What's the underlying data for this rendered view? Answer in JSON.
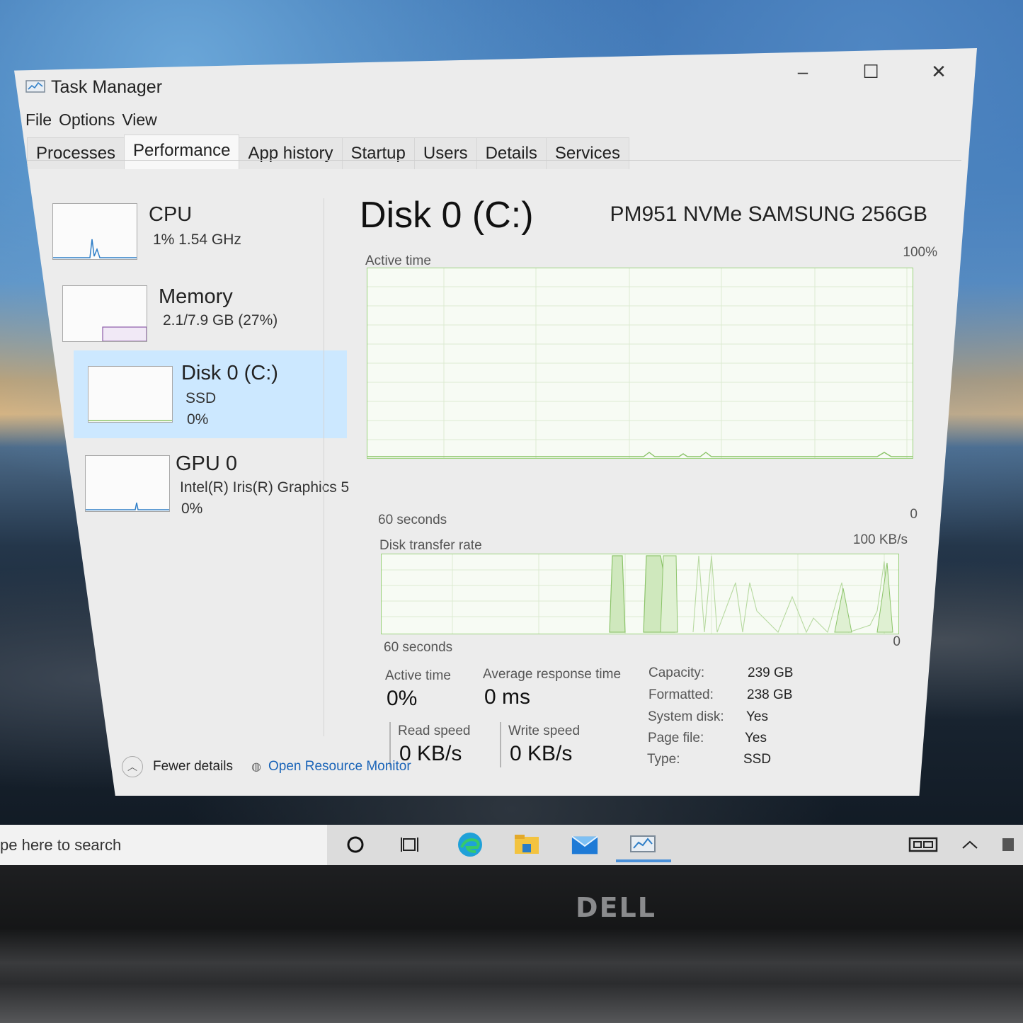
{
  "window": {
    "title": "Task Manager",
    "controls": {
      "minimize": "–",
      "maximize": "☐",
      "close": "✕"
    }
  },
  "menu": [
    "File",
    "Options",
    "View"
  ],
  "tabs": [
    "Processes",
    "Performance",
    "App history",
    "Startup",
    "Users",
    "Details",
    "Services"
  ],
  "active_tab": "Performance",
  "sidebar": {
    "items": [
      {
        "name": "CPU",
        "line1": "1%  1.54 GHz",
        "line2": ""
      },
      {
        "name": "Memory",
        "line1": "2.1/7.9 GB (27%)",
        "line2": ""
      },
      {
        "name": "Disk 0 (C:)",
        "line1": "SSD",
        "line2": "0%"
      },
      {
        "name": "GPU 0",
        "line1": "Intel(R) Iris(R) Graphics 5",
        "line2": "0%"
      }
    ]
  },
  "main": {
    "title": "Disk 0 (C:)",
    "model": "PM951 NVMe SAMSUNG 256GB",
    "active_graph": {
      "label": "Active time",
      "max": "100%",
      "time": "60 seconds",
      "min": "0"
    },
    "transfer_graph": {
      "label": "Disk transfer rate",
      "max": "100 KB/s",
      "time": "60 seconds",
      "min": "0"
    },
    "stats": {
      "active_time": {
        "label": "Active time",
        "value": "0%"
      },
      "avg_response": {
        "label": "Average response time",
        "value": "0 ms"
      },
      "read_speed": {
        "label": "Read speed",
        "value": "0 KB/s"
      },
      "write_speed": {
        "label": "Write speed",
        "value": "0 KB/s"
      }
    },
    "details": [
      {
        "label": "Capacity:",
        "value": "239 GB"
      },
      {
        "label": "Formatted:",
        "value": "238 GB"
      },
      {
        "label": "System disk:",
        "value": "Yes"
      },
      {
        "label": "Page file:",
        "value": "Yes"
      },
      {
        "label": "Type:",
        "value": "SSD"
      }
    ]
  },
  "footer": {
    "fewer_details": "Fewer details",
    "open_resource_monitor": "Open Resource Monitor"
  },
  "taskbar": {
    "search_placeholder": "pe here to search",
    "icons": [
      "cortana-circle-icon",
      "task-view-icon",
      "edge-icon",
      "file-explorer-icon",
      "mail-icon",
      "task-manager-icon",
      "keyboard-icon",
      "chevron-up-icon",
      "notification-icon"
    ]
  },
  "bezel": {
    "brand": "DELL"
  },
  "colors": {
    "accent": "#cce8ff",
    "graph_line": "#8cc46a",
    "link": "#1a64b8"
  }
}
